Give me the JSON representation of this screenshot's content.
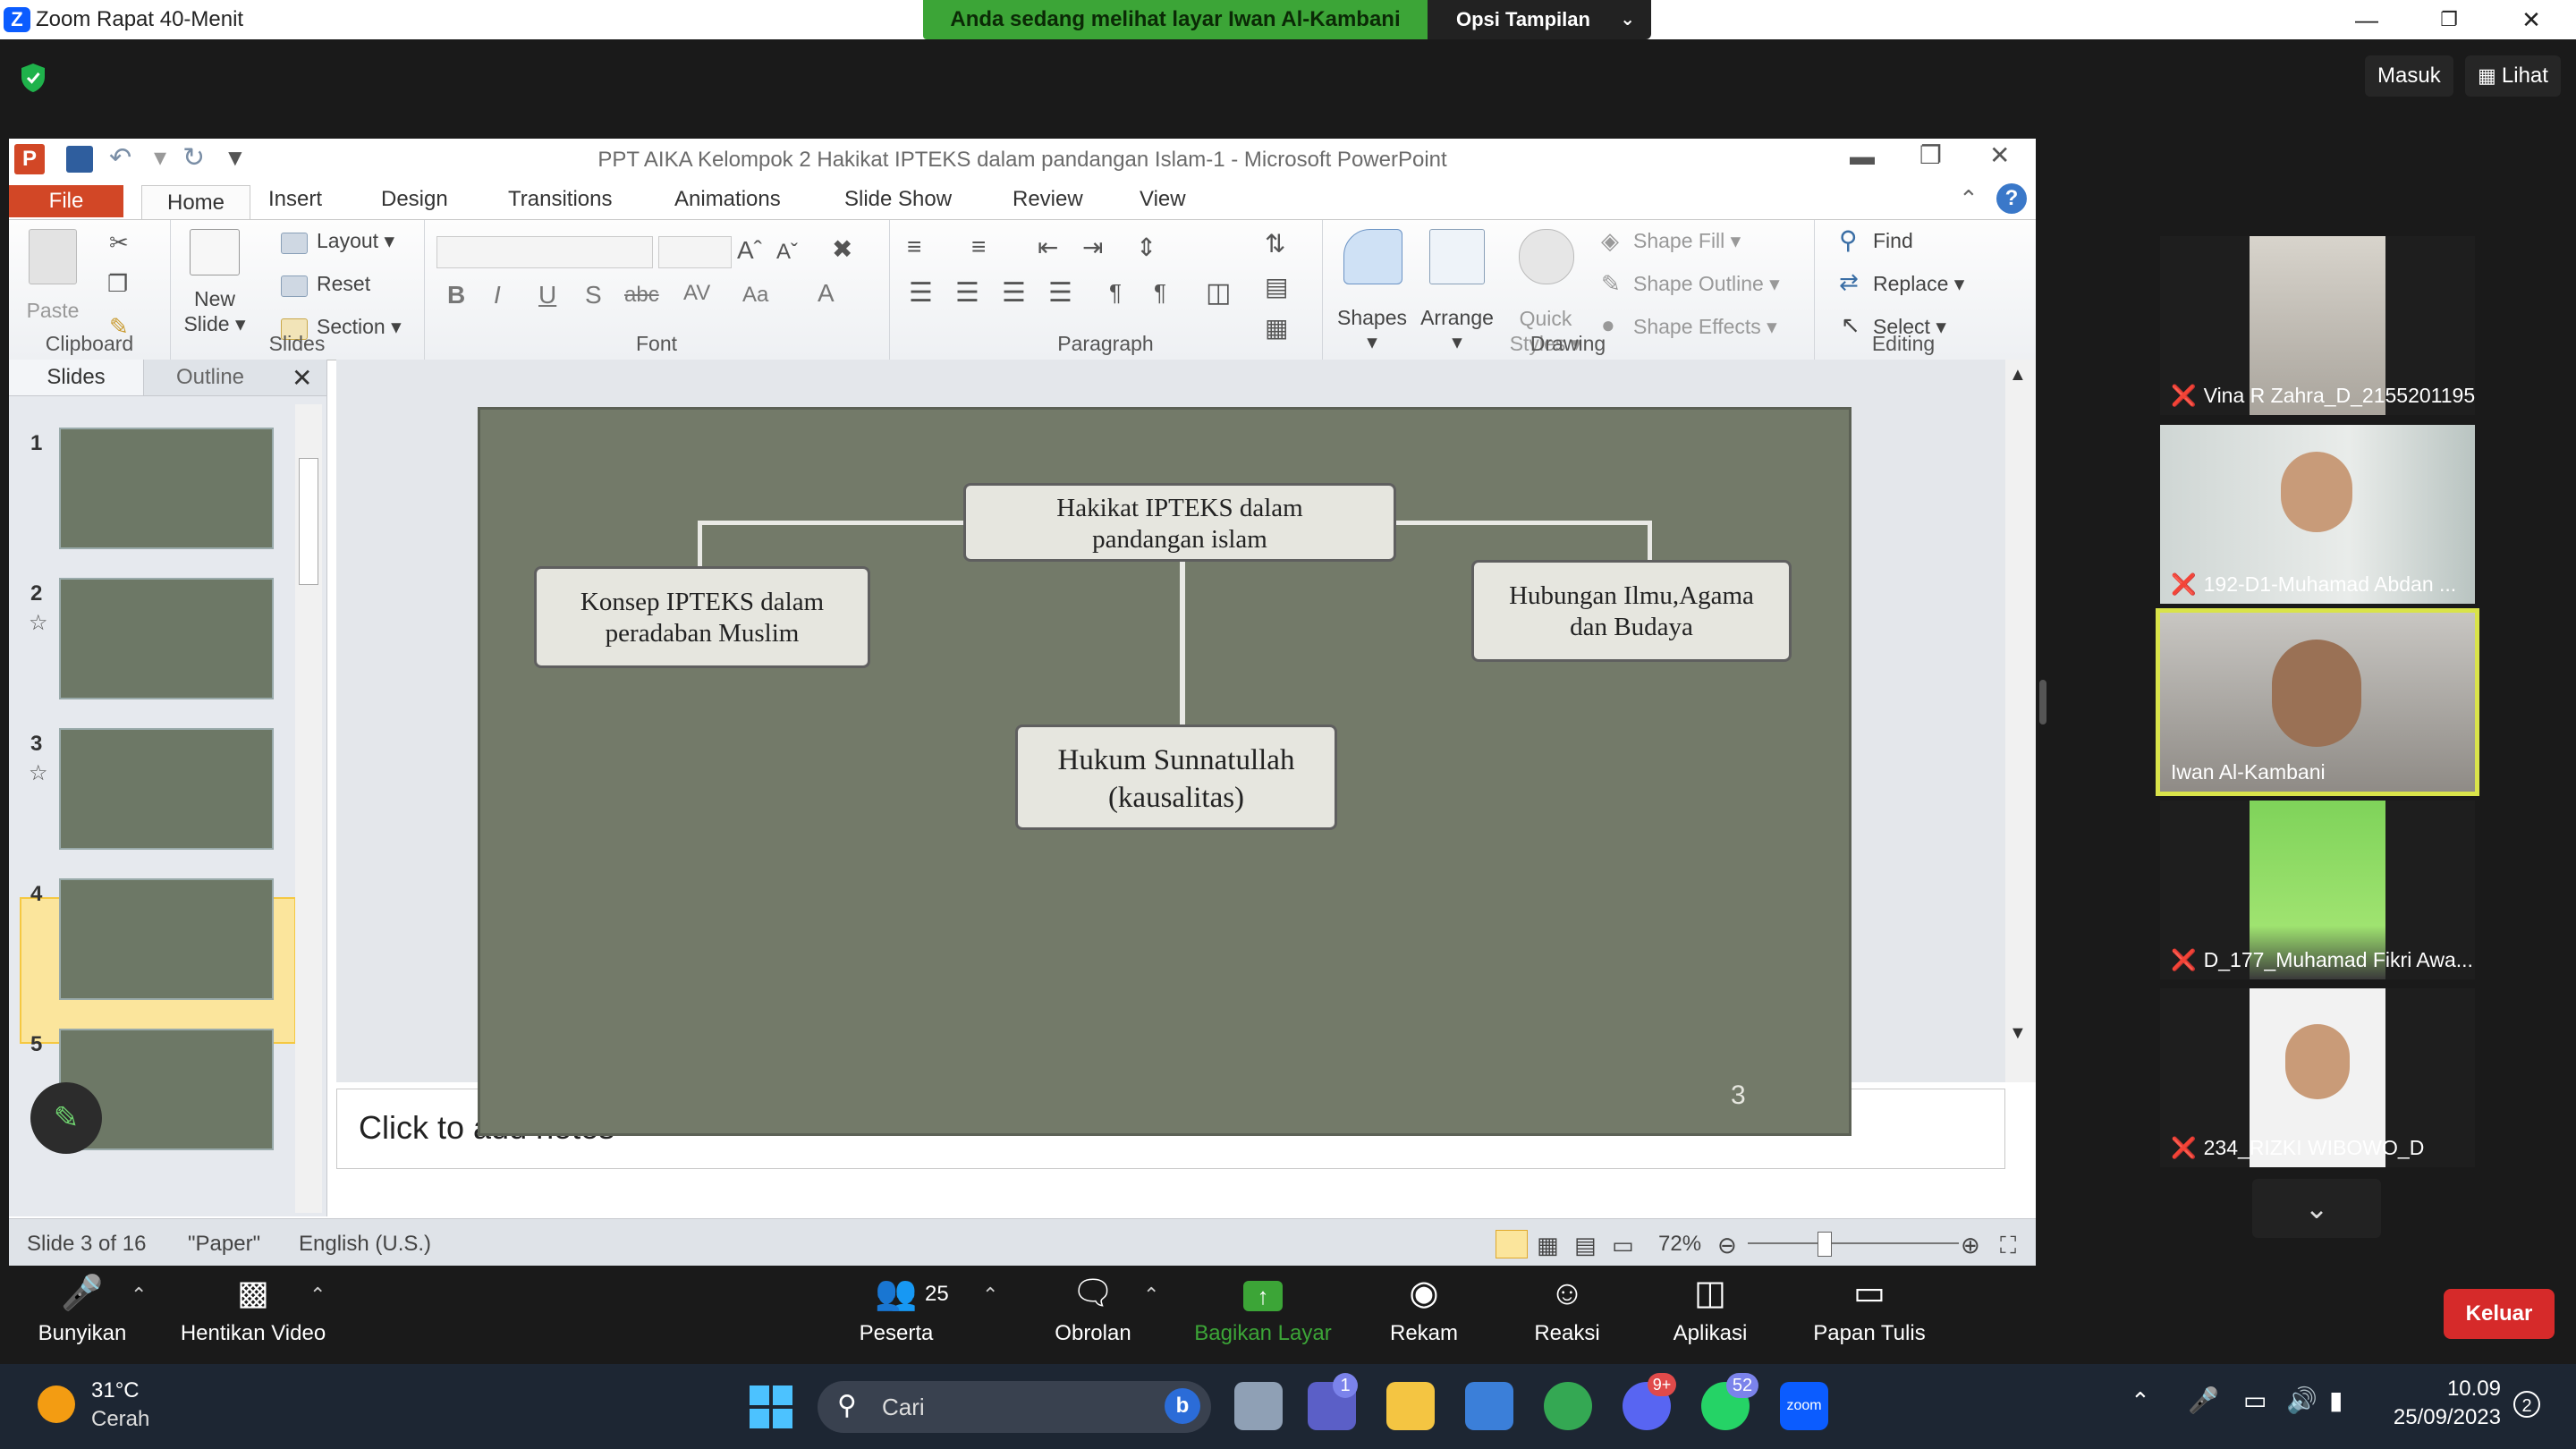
{
  "zoom": {
    "window_title": "Zoom Rapat 40-Menit",
    "share_banner": "Anda sedang melihat layar Iwan Al-Kambani",
    "view_options": "Opsi Tampilan",
    "top_right": {
      "enter": "Masuk",
      "view": "Lihat"
    },
    "toolbar": {
      "unmute": "Bunyikan",
      "stop_video": "Hentikan Video",
      "participants": "Peserta",
      "participants_count": "25",
      "chat": "Obrolan",
      "share_screen": "Bagikan Layar",
      "record": "Rekam",
      "reactions": "Reaksi",
      "apps": "Aplikasi",
      "whiteboard": "Papan Tulis",
      "leave": "Keluar"
    },
    "participants_list": [
      {
        "name": "Vina R Zahra_D_2155201195",
        "muted": true
      },
      {
        "name": "192-D1-Muhamad Abdan ...",
        "muted": true
      },
      {
        "name": "Iwan Al-Kambani",
        "muted": false,
        "active": true
      },
      {
        "name": "D_177_Muhamad Fikri Awa...",
        "muted": true
      },
      {
        "name": "234_RIZKI WIBOWO_D",
        "muted": true
      }
    ],
    "accent": "#3ca537",
    "leave_color": "#d62a2a"
  },
  "ppt": {
    "title": "PPT AIKA Kelompok 2 Hakikat IPTEKS dalam pandangan Islam-1  -  Microsoft PowerPoint",
    "tabs": [
      "File",
      "Home",
      "Insert",
      "Design",
      "Transitions",
      "Animations",
      "Slide Show",
      "Review",
      "View"
    ],
    "ribbon": {
      "clipboard": {
        "label": "Clipboard",
        "paste": "Paste"
      },
      "slides": {
        "label": "Slides",
        "new_slide_1": "New",
        "new_slide_2": "Slide",
        "layout": "Layout",
        "reset": "Reset",
        "section": "Section"
      },
      "font": {
        "label": "Font"
      },
      "paragraph": {
        "label": "Paragraph"
      },
      "drawing": {
        "label": "Drawing",
        "shapes": "Shapes",
        "arrange": "Arrange",
        "quick_1": "Quick",
        "quick_2": "Styles",
        "fill": "Shape Fill",
        "outline": "Shape Outline",
        "effects": "Shape Effects"
      },
      "editing": {
        "label": "Editing",
        "find": "Find",
        "replace": "Replace",
        "select": "Select"
      }
    },
    "pane_tabs": {
      "slides": "Slides",
      "outline": "Outline"
    },
    "thumbs": [
      "1",
      "2",
      "3",
      "4",
      "5"
    ],
    "slide": {
      "center": "Hakikat  IPTEKS dalam pandangan  islam",
      "center_l1": "Hakikat  IPTEKS dalam",
      "center_l2": "pandangan  islam",
      "left_l1": "Konsep  IPTEKS dalam",
      "left_l2": "peradaban  Muslim",
      "right_l1": "Hubungan  Ilmu,Agama",
      "right_l2": "dan Budaya",
      "bottom_l1": "Hukum Sunnatullah",
      "bottom_l2": "(kausalitas)",
      "number": "3"
    },
    "notes_placeholder": "Click to add notes",
    "status": {
      "slide": "Slide 3 of 16",
      "theme": "\"Paper\"",
      "language": "English (U.S.)",
      "zoom": "72%"
    }
  },
  "taskbar": {
    "temp": "31°C",
    "weather": "Cerah",
    "search": "Cari",
    "time": "10.09",
    "date": "25/09/2023",
    "badges": {
      "teams": "1",
      "discord": "9+",
      "whatsapp": "52",
      "notif": "2"
    }
  }
}
